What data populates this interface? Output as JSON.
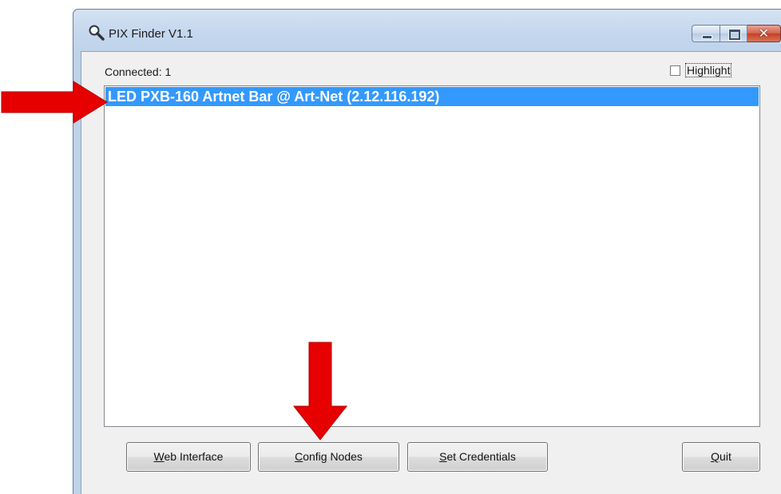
{
  "window": {
    "title": "PIX Finder V1.1",
    "icon": "magnifier-icon"
  },
  "status": {
    "connected": "Connected: 1"
  },
  "highlight": {
    "label": "Highlight",
    "checked": false
  },
  "nodes": [
    {
      "label": "LED PXB-160 Artnet Bar @ Art-Net (2.12.116.192)",
      "selected": true
    }
  ],
  "buttons": {
    "web_interface": {
      "mnemonic": "W",
      "rest": "eb Interface"
    },
    "config_nodes": {
      "mnemonic": "C",
      "rest": "onfig Nodes"
    },
    "set_credentials": {
      "mnemonic": "S",
      "rest": "et Credentials"
    },
    "quit": {
      "mnemonic": "Q",
      "rest": "uit"
    }
  },
  "colors": {
    "selection": "#3399ff",
    "annotation_arrow": "#e60000"
  }
}
